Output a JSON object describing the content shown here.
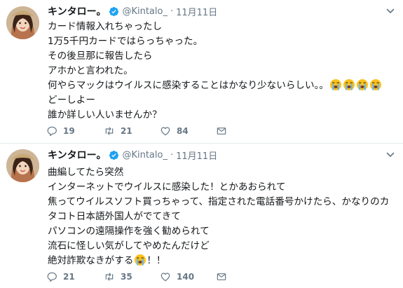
{
  "tweets": [
    {
      "display_name": "キンタロー。",
      "handle": "@Kintalo_",
      "separator": "·",
      "date": "11月11日",
      "lines": [
        "カード情報入れちゃったし",
        "1万5千円カードではらっちゃった。",
        "その後旦那に報告したら",
        "アホかと言われた。",
        "何やらマックはウイルスに感染することはかなり少ないらしい。。",
        "どーしよー",
        "誰か詳しい人いませんか？"
      ],
      "replies": "19",
      "retweets": "21",
      "likes": "84"
    },
    {
      "display_name": "キンタロー。",
      "handle": "@Kintalo_",
      "separator": "·",
      "date": "11月11日",
      "lines": [
        "曲編してたら突然",
        "インターネットでウイルスに感染した！とかあおられて",
        "焦ってウイルスソフト買っちゃって、指定された電話番号かけたら、かなりのカ",
        "タコト日本語外国人がでてきて",
        "パソコンの遠隔操作を強く勧められて",
        "流石に怪しい気がしてやめたんだけど",
        "絶対詐欺なきがする",
        "！！"
      ],
      "replies": "21",
      "retweets": "35",
      "likes": "140"
    }
  ],
  "icons": {
    "verified": "verified-badge-icon",
    "reply": "reply-icon",
    "retweet": "retweet-icon",
    "like": "heart-icon",
    "dm": "envelope-icon",
    "caret": "chevron-down-icon",
    "emoji": "loudly-crying-face-emoji"
  },
  "colors": {
    "text": "#14171a",
    "secondary": "#657786",
    "verified": "#1da1f2",
    "divider": "#e6ecf0"
  }
}
